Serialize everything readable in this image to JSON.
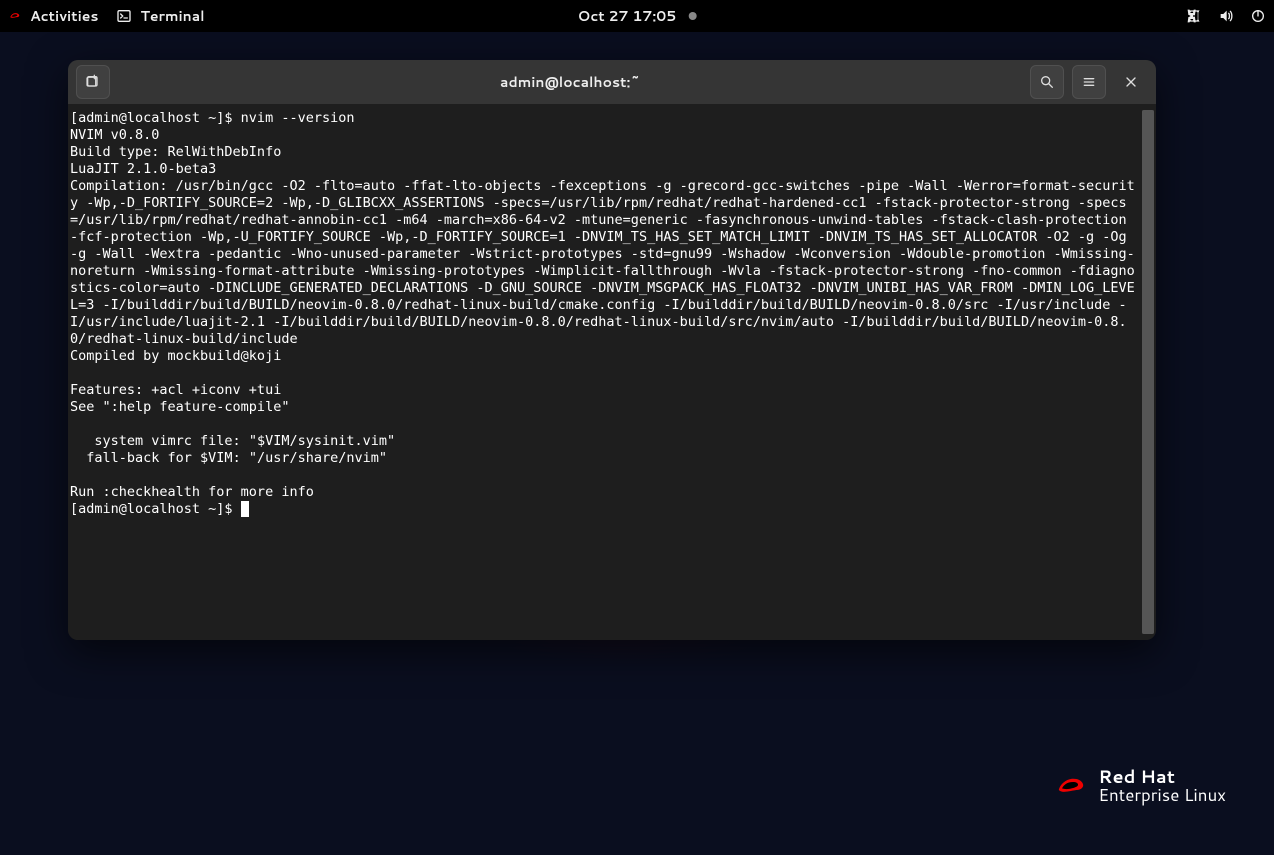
{
  "topbar": {
    "activities": "Activities",
    "app_name": "Terminal",
    "clock": "Oct 27  17:05"
  },
  "window": {
    "title": "admin@localhost:~"
  },
  "terminal": {
    "content": "[admin@localhost ~]$ nvim --version\nNVIM v0.8.0\nBuild type: RelWithDebInfo\nLuaJIT 2.1.0-beta3\nCompilation: /usr/bin/gcc -O2 -flto=auto -ffat-lto-objects -fexceptions -g -grecord-gcc-switches -pipe -Wall -Werror=format-security -Wp,-D_FORTIFY_SOURCE=2 -Wp,-D_GLIBCXX_ASSERTIONS -specs=/usr/lib/rpm/redhat/redhat-hardened-cc1 -fstack-protector-strong -specs=/usr/lib/rpm/redhat/redhat-annobin-cc1 -m64 -march=x86-64-v2 -mtune=generic -fasynchronous-unwind-tables -fstack-clash-protection -fcf-protection -Wp,-U_FORTIFY_SOURCE -Wp,-D_FORTIFY_SOURCE=1 -DNVIM_TS_HAS_SET_MATCH_LIMIT -DNVIM_TS_HAS_SET_ALLOCATOR -O2 -g -Og -g -Wall -Wextra -pedantic -Wno-unused-parameter -Wstrict-prototypes -std=gnu99 -Wshadow -Wconversion -Wdouble-promotion -Wmissing-noreturn -Wmissing-format-attribute -Wmissing-prototypes -Wimplicit-fallthrough -Wvla -fstack-protector-strong -fno-common -fdiagnostics-color=auto -DINCLUDE_GENERATED_DECLARATIONS -D_GNU_SOURCE -DNVIM_MSGPACK_HAS_FLOAT32 -DNVIM_UNIBI_HAS_VAR_FROM -DMIN_LOG_LEVEL=3 -I/builddir/build/BUILD/neovim-0.8.0/redhat-linux-build/cmake.config -I/builddir/build/BUILD/neovim-0.8.0/src -I/usr/include -I/usr/include/luajit-2.1 -I/builddir/build/BUILD/neovim-0.8.0/redhat-linux-build/src/nvim/auto -I/builddir/build/BUILD/neovim-0.8.0/redhat-linux-build/include\nCompiled by mockbuild@koji\n\nFeatures: +acl +iconv +tui\nSee \":help feature-compile\"\n\n   system vimrc file: \"$VIM/sysinit.vim\"\n  fall-back for $VIM: \"/usr/share/nvim\"\n\nRun :checkhealth for more info\n[admin@localhost ~]$ "
  },
  "branding": {
    "line1": "Red Hat",
    "line2": "Enterprise Linux"
  }
}
